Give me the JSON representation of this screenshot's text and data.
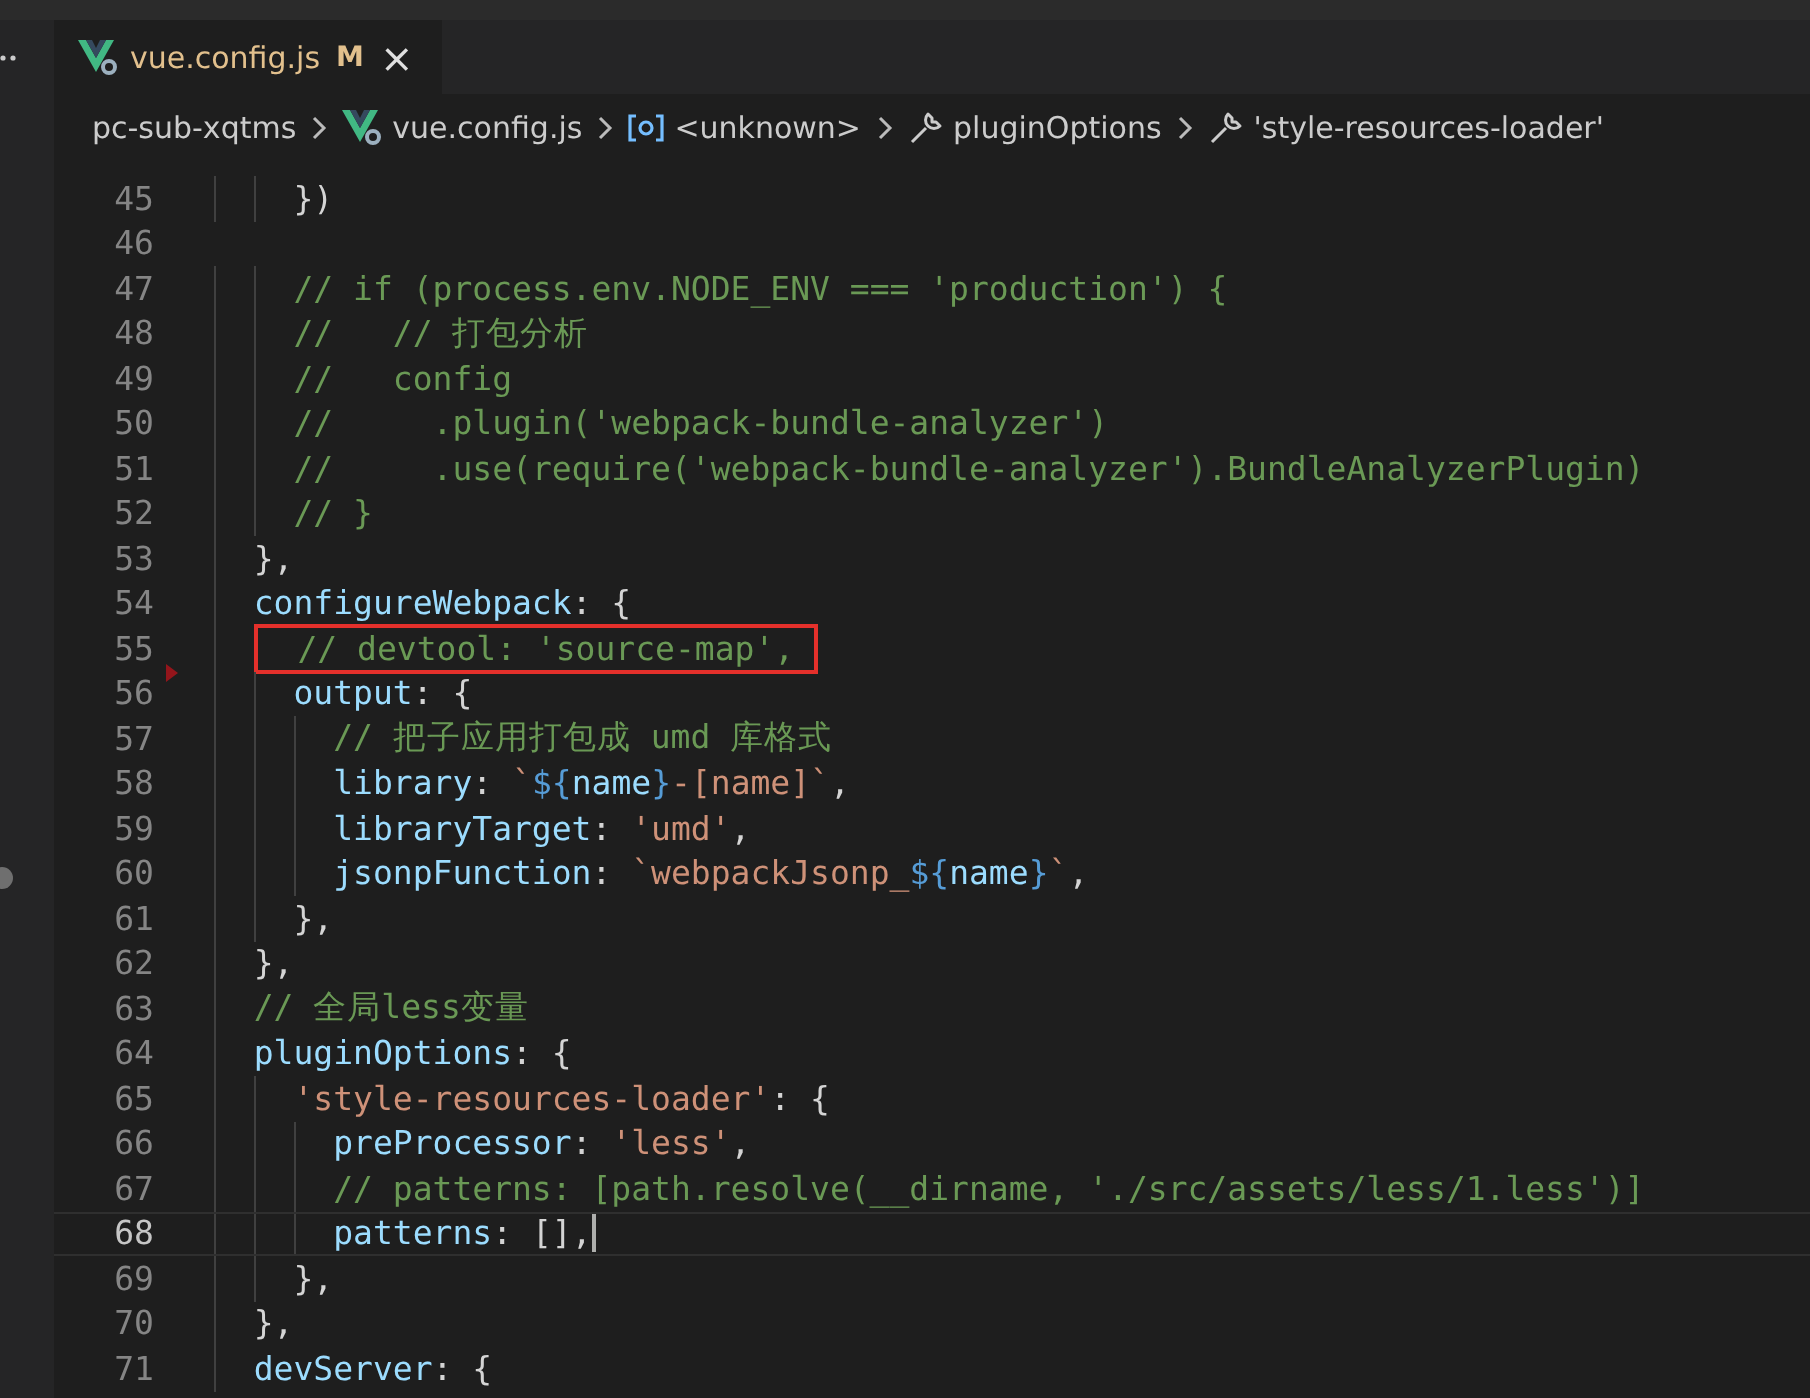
{
  "tab": {
    "filename": "vue.config.js",
    "badge": "M",
    "close": "×",
    "modified": true,
    "selected": true
  },
  "breadcrumb": [
    {
      "kind": "folder",
      "text": "pc-sub-xqtms"
    },
    {
      "kind": "vue",
      "text": "vue.config.js"
    },
    {
      "kind": "symbol",
      "text": "<unknown>"
    },
    {
      "kind": "wrench",
      "text": "pluginOptions"
    },
    {
      "kind": "wrench",
      "text": "'style-resources-loader'"
    }
  ],
  "editor": {
    "lines": [
      {
        "number": "45",
        "current": false,
        "highlighted": false,
        "deleted_above": false,
        "tokens": [
          {
            "kind": "p",
            "text": "    })"
          }
        ]
      },
      {
        "number": "46",
        "current": false,
        "highlighted": false,
        "deleted_above": false
      },
      {
        "number": "47",
        "current": false,
        "highlighted": false,
        "deleted_above": false,
        "tokens": [
          {
            "kind": "c",
            "text": "    // if (process.env.NODE_ENV === 'production') {"
          }
        ]
      },
      {
        "number": "48",
        "current": false,
        "highlighted": false,
        "deleted_above": false,
        "tokens": [
          {
            "kind": "c",
            "text": "    //   // 打包分析"
          }
        ]
      },
      {
        "number": "49",
        "current": false,
        "highlighted": false,
        "deleted_above": false,
        "tokens": [
          {
            "kind": "c",
            "text": "    //   config"
          }
        ]
      },
      {
        "number": "50",
        "current": false,
        "highlighted": false,
        "deleted_above": false,
        "tokens": [
          {
            "kind": "c",
            "text": "    //     .plugin('webpack-bundle-analyzer')"
          }
        ]
      },
      {
        "number": "51",
        "current": false,
        "highlighted": false,
        "deleted_above": false,
        "tokens": [
          {
            "kind": "c",
            "text": "    //     .use(require('webpack-bundle-analyzer').BundleAnalyzerPlugin)"
          }
        ]
      },
      {
        "number": "52",
        "current": false,
        "highlighted": false,
        "deleted_above": false,
        "tokens": [
          {
            "kind": "c",
            "text": "    // }"
          }
        ]
      },
      {
        "number": "53",
        "current": false,
        "highlighted": false,
        "deleted_above": false,
        "tokens": [
          {
            "kind": "p",
            "text": "  },"
          }
        ]
      },
      {
        "number": "54",
        "current": false,
        "highlighted": false,
        "deleted_above": false,
        "tokens": [
          {
            "kind": "k",
            "text": "  configureWebpack"
          },
          {
            "kind": "p",
            "text": ": {"
          }
        ]
      },
      {
        "number": "55",
        "current": false,
        "highlighted": true,
        "deleted_above": false,
        "tokens": [
          {
            "kind": "c",
            "text": "    // devtool: 'source-map',"
          }
        ]
      },
      {
        "number": "56",
        "current": false,
        "highlighted": false,
        "deleted_above": true,
        "tokens": [
          {
            "kind": "k",
            "text": "    output"
          },
          {
            "kind": "p",
            "text": ": {"
          }
        ]
      },
      {
        "number": "57",
        "current": false,
        "highlighted": false,
        "deleted_above": false,
        "tokens": [
          {
            "kind": "c",
            "text": "      // 把子应用打包成 umd 库格式"
          }
        ]
      },
      {
        "number": "58",
        "current": false,
        "highlighted": false,
        "deleted_above": false,
        "tokens": [
          {
            "kind": "k",
            "text": "      library"
          },
          {
            "kind": "p",
            "text": ": "
          },
          {
            "kind": "s",
            "text": "`"
          },
          {
            "kind": "t",
            "text": "${"
          },
          {
            "kind": "k",
            "text": "name"
          },
          {
            "kind": "t",
            "text": "}"
          },
          {
            "kind": "s",
            "text": "-[name]`"
          },
          {
            "kind": "p",
            "text": ","
          }
        ]
      },
      {
        "number": "59",
        "current": false,
        "highlighted": false,
        "deleted_above": false,
        "tokens": [
          {
            "kind": "k",
            "text": "      libraryTarget"
          },
          {
            "kind": "p",
            "text": ": "
          },
          {
            "kind": "s",
            "text": "'umd'"
          },
          {
            "kind": "p",
            "text": ","
          }
        ]
      },
      {
        "number": "60",
        "current": false,
        "highlighted": false,
        "deleted_above": false,
        "tokens": [
          {
            "kind": "k",
            "text": "      jsonpFunction"
          },
          {
            "kind": "p",
            "text": ": "
          },
          {
            "kind": "s",
            "text": "`webpackJsonp_"
          },
          {
            "kind": "t",
            "text": "${"
          },
          {
            "kind": "k",
            "text": "name"
          },
          {
            "kind": "t",
            "text": "}"
          },
          {
            "kind": "s",
            "text": "`"
          },
          {
            "kind": "p",
            "text": ","
          }
        ]
      },
      {
        "number": "61",
        "current": false,
        "highlighted": false,
        "deleted_above": false,
        "tokens": [
          {
            "kind": "p",
            "text": "    },"
          }
        ]
      },
      {
        "number": "62",
        "current": false,
        "highlighted": false,
        "deleted_above": false,
        "tokens": [
          {
            "kind": "p",
            "text": "  },"
          }
        ]
      },
      {
        "number": "63",
        "current": false,
        "highlighted": false,
        "deleted_above": false,
        "tokens": [
          {
            "kind": "c",
            "text": "  // 全局less变量"
          }
        ]
      },
      {
        "number": "64",
        "current": false,
        "highlighted": false,
        "deleted_above": false,
        "tokens": [
          {
            "kind": "k",
            "text": "  pluginOptions"
          },
          {
            "kind": "p",
            "text": ": {"
          }
        ]
      },
      {
        "number": "65",
        "current": false,
        "highlighted": false,
        "deleted_above": false,
        "tokens": [
          {
            "kind": "s",
            "text": "    'style-resources-loader'"
          },
          {
            "kind": "p",
            "text": ": {"
          }
        ]
      },
      {
        "number": "66",
        "current": false,
        "highlighted": false,
        "deleted_above": false,
        "tokens": [
          {
            "kind": "k",
            "text": "      preProcessor"
          },
          {
            "kind": "p",
            "text": ": "
          },
          {
            "kind": "s",
            "text": "'less'"
          },
          {
            "kind": "p",
            "text": ","
          }
        ]
      },
      {
        "number": "67",
        "current": false,
        "highlighted": false,
        "deleted_above": false,
        "tokens": [
          {
            "kind": "c",
            "text": "      // patterns: [path.resolve(__dirname, './src/assets/less/1.less')]"
          }
        ]
      },
      {
        "number": "68",
        "current": true,
        "highlighted": false,
        "deleted_above": false,
        "tokens": [
          {
            "kind": "k",
            "text": "      patterns"
          },
          {
            "kind": "p",
            "text": ": [],"
          }
        ]
      },
      {
        "number": "69",
        "current": false,
        "highlighted": false,
        "deleted_above": false,
        "tokens": [
          {
            "kind": "p",
            "text": "    },"
          }
        ]
      },
      {
        "number": "70",
        "current": false,
        "highlighted": false,
        "deleted_above": false,
        "tokens": [
          {
            "kind": "p",
            "text": "  },"
          }
        ]
      },
      {
        "number": "71",
        "current": false,
        "highlighted": false,
        "deleted_above": false,
        "tokens": [
          {
            "kind": "k",
            "text": "  devServer"
          },
          {
            "kind": "p",
            "text": ": {"
          }
        ]
      }
    ]
  }
}
